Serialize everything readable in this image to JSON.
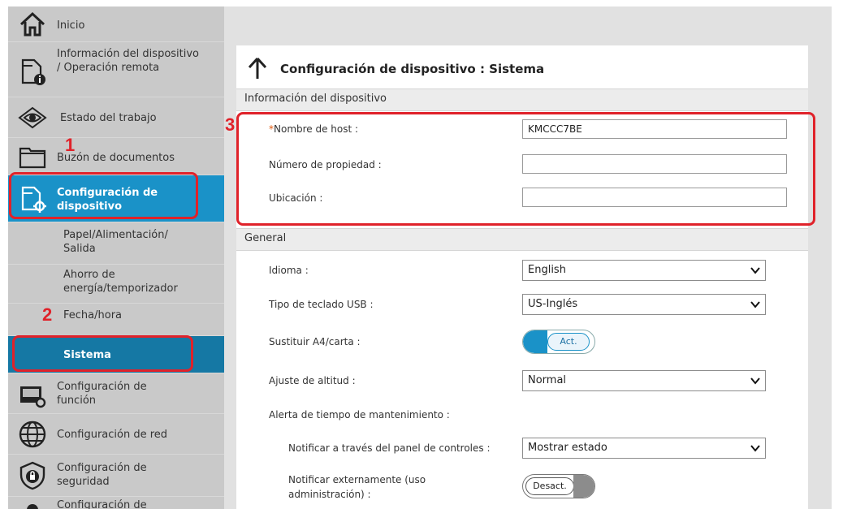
{
  "sidebar": {
    "items": [
      {
        "label": "Inicio",
        "icon": "home-icon"
      },
      {
        "label": "Información del dispositivo / Operación remota",
        "icon": "device-info-icon"
      },
      {
        "label": "Estado del trabajo",
        "icon": "eye-icon"
      },
      {
        "label": "Buzón de documentos",
        "icon": "folder-icon"
      },
      {
        "label": "Configuración de dispositivo",
        "icon": "device-settings-icon",
        "active": true
      },
      {
        "label": "Papel/Alimentación/ Salida"
      },
      {
        "label": "Ahorro de energía/temporizador"
      },
      {
        "label": "Fecha/hora"
      },
      {
        "label": "Sistema",
        "active": true
      },
      {
        "label": "Configuración de función",
        "icon": "function-settings-icon"
      },
      {
        "label": "Configuración de red",
        "icon": "globe-icon"
      },
      {
        "label": "Configuración de seguridad",
        "icon": "shield-lock-icon"
      },
      {
        "label": "Configuración de",
        "icon": "user-icon"
      }
    ]
  },
  "page": {
    "title": "Configuración de dispositivo : Sistema"
  },
  "sections": {
    "device_info": "Información del dispositivo",
    "general": "General"
  },
  "fields": {
    "host_required_mark": "*",
    "host_label": "Nombre de host :",
    "host_value": "KMCCC7BE",
    "asset_label": "Número de propiedad :",
    "asset_value": "",
    "location_label": "Ubicación :",
    "location_value": "",
    "language_label": "Idioma :",
    "language_value": "English",
    "usb_keyboard_label": "Tipo de teclado USB :",
    "usb_keyboard_value": "US-Inglés",
    "replace_a4_label": "Sustituir A4/carta :",
    "replace_a4_value": "Act.",
    "altitude_label": "Ajuste de altitud :",
    "altitude_value": "Normal",
    "maintenance_alert_label": "Alerta de tiempo de mantenimiento :",
    "notify_panel_label": "Notificar a través del panel de controles :",
    "notify_panel_value": "Mostrar estado",
    "notify_external_label": "Notificar externamente (uso administración) :",
    "notify_external_value": "Desact."
  },
  "annotations": {
    "step1": "1",
    "step2": "2",
    "step3": "3"
  },
  "colors": {
    "accent": "#1a92c8",
    "active_sub": "#1578a4",
    "annotation": "#e0222a",
    "sidebar_bg": "#c9c9c9"
  }
}
